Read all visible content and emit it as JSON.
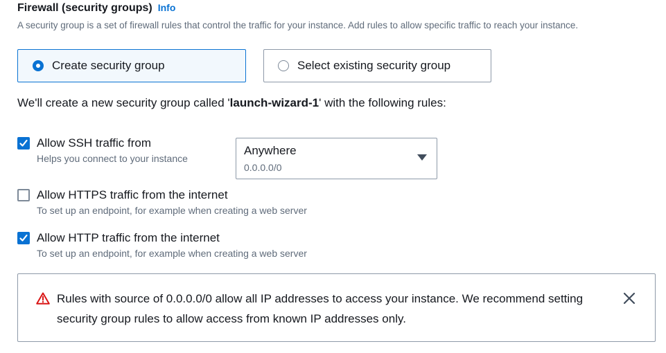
{
  "section": {
    "title": "Firewall (security groups)",
    "info_link": "Info",
    "description": "A security group is a set of firewall rules that control the traffic for your instance. Add rules to allow specific traffic to reach your instance."
  },
  "options": {
    "create": {
      "label": "Create security group",
      "selected": true
    },
    "existing": {
      "label": "Select existing security group",
      "selected": false
    }
  },
  "statement": {
    "prefix": "We'll create a new security group called '",
    "group_name": "launch-wizard-1",
    "suffix": "' with the following rules:"
  },
  "rules": {
    "ssh": {
      "label": "Allow SSH traffic from",
      "helper": "Helps you connect to your instance",
      "checked": true
    },
    "https": {
      "label": "Allow HTTPS traffic from the internet",
      "helper": "To set up an endpoint, for example when creating a web server",
      "checked": false
    },
    "http": {
      "label": "Allow HTTP traffic from the internet",
      "helper": "To set up an endpoint, for example when creating a web server",
      "checked": true
    }
  },
  "ssh_source_select": {
    "value": "Anywhere",
    "sub_value": "0.0.0.0/0",
    "icon": "caret-down-icon"
  },
  "alert": {
    "icon": "warning-icon",
    "message": "Rules with source of 0.0.0.0/0 allow all IP addresses to access your instance. We recommend setting security group rules to allow access from known IP addresses only.",
    "dismiss_icon": "close-icon"
  },
  "colors": {
    "accent": "#0972d3",
    "warning": "#d91515",
    "text": "#16191f",
    "muted": "#5f6b7a",
    "border": "#8d99a8"
  }
}
